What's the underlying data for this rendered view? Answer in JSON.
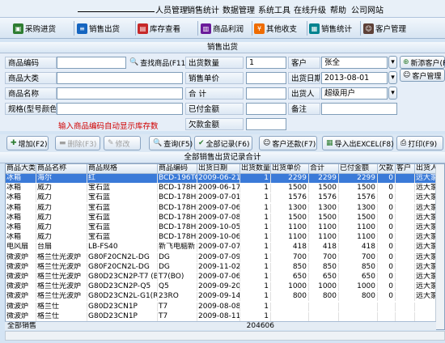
{
  "menu": [
    "人员管理",
    "销售统计",
    "数据管理",
    "系统工具",
    "在线升级",
    "帮助",
    "公司网站"
  ],
  "toolbar": [
    "采购进货",
    "销售出货",
    "库存查看",
    "商品利润",
    "其他收支",
    "销售统计",
    "客户管理"
  ],
  "form_title": "销售出货",
  "form": {
    "code_label": "商品编码",
    "code_value": "",
    "find_button": "查找商品(F11)",
    "qty_label": "出货数量",
    "qty_value": "1",
    "customer_label": "客户",
    "customer_value": "张全",
    "new_customer": "新添客户(F",
    "category_label": "商品大类",
    "category_value": "",
    "price_label": "销售单价",
    "price_value": "",
    "date_label": "出货日期",
    "date_value": "2013-08-01",
    "customer_manage": "客户管理",
    "name_label": "商品名称",
    "name_value": "",
    "total_label": "合  计",
    "total_value": "",
    "shipper_label": "出货人",
    "shipper_value": "超级用户",
    "spec_label": "规格(型号颜色)",
    "spec_value": "",
    "paid_label": "已付金额",
    "paid_value": "",
    "remark_label": "备注",
    "remark_value": "",
    "owed_label": "欠款金额",
    "owed_value": "",
    "hint": "输入商品编码自动显示库存数"
  },
  "actions": [
    "增加(F2)",
    "删除(F3)",
    "修改",
    "查询(F5)",
    "全部记录(F6)",
    "客户还款(F7)",
    "导入出EXCEL(F8)",
    "打印(F9)"
  ],
  "grid_title": "全部销售出货记录合计",
  "columns": [
    "商品大类",
    "商品名称",
    "商品规格",
    "商品编码",
    "出货日期",
    "出货数量",
    "出货单价",
    "合计",
    "已付金额",
    "欠款",
    "客户",
    "出货人"
  ],
  "rows": [
    [
      "冰箱",
      "海尔",
      "红",
      "BCD-196TC",
      "2009-06-21",
      "1",
      "2299",
      "2299",
      "2299",
      "0",
      "",
      "远大家电"
    ],
    [
      "冰箱",
      "威力",
      "宝石蓝",
      "BCD-178H",
      "2009-06-17",
      "1",
      "1500",
      "1500",
      "1500",
      "0",
      "",
      "远大家电"
    ],
    [
      "冰箱",
      "威力",
      "宝石蓝",
      "BCD-178H",
      "2009-07-01",
      "1",
      "1576",
      "1576",
      "1576",
      "0",
      "",
      "远大家电"
    ],
    [
      "冰箱",
      "威力",
      "宝石蓝",
      "BCD-178H",
      "2009-07-06",
      "1",
      "1300",
      "1300",
      "1300",
      "0",
      "",
      "远大家电"
    ],
    [
      "冰箱",
      "威力",
      "宝石蓝",
      "BCD-178H",
      "2009-07-08",
      "1",
      "1500",
      "1500",
      "1500",
      "0",
      "",
      "远大家电"
    ],
    [
      "冰箱",
      "威力",
      "宝石蓝",
      "BCD-178H",
      "2009-10-05",
      "1",
      "1100",
      "1100",
      "1100",
      "0",
      "",
      "远大家电"
    ],
    [
      "冰箱",
      "威力",
      "宝石蓝",
      "BCD-178H",
      "2009-10-06",
      "1",
      "1100",
      "1100",
      "1100",
      "0",
      "",
      "远大家电"
    ],
    [
      "电风扇",
      "台扇",
      "LB-FS40",
      "新飞电脑新",
      "2009-07-07",
      "1",
      "418",
      "418",
      "418",
      "0",
      "",
      "远大家电"
    ],
    [
      "微波炉",
      "格兰仕光波炉",
      "G80F20CN2L-DG",
      "DG",
      "2009-07-09",
      "1",
      "700",
      "700",
      "700",
      "0",
      "",
      "远大家电"
    ],
    [
      "微波炉",
      "格兰仕光波炉",
      "G80F20CN2L-DG",
      "DG",
      "2009-11-02",
      "1",
      "850",
      "850",
      "850",
      "0",
      "",
      "远大家电"
    ],
    [
      "微波炉",
      "格兰仕光波炉",
      "G80D23CN2P-T7 (BO",
      "T7(BO)",
      "2009-07-06",
      "1",
      "650",
      "650",
      "650",
      "0",
      "",
      "远大家电"
    ],
    [
      "微波炉",
      "格兰仕光波炉",
      "G80D23CN2P-Q5",
      "Q5",
      "2009-09-20",
      "1",
      "1000",
      "1000",
      "1000",
      "0",
      "",
      "远大家电"
    ],
    [
      "微波炉",
      "格兰仕光波炉",
      "G80D23CN2L-G1(R0",
      "23RO",
      "2009-09-14",
      "1",
      "800",
      "800",
      "800",
      "0",
      "",
      "远大家电"
    ],
    [
      "微波炉",
      "格兰仕",
      "G80D23CN1P",
      "T7",
      "2009-08-08",
      "1",
      "",
      "",
      "",
      "",
      "",
      ""
    ],
    [
      "微波炉",
      "格兰仕",
      "G80D23CN1P",
      "T7",
      "2009-08-11",
      "1",
      "",
      "",
      "",
      "",
      "",
      ""
    ]
  ],
  "footer": {
    "label": "全部销售",
    "total": "204606"
  }
}
